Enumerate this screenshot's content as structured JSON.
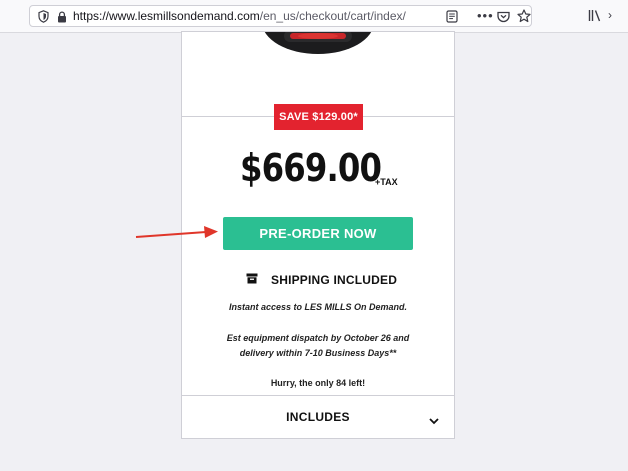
{
  "browser": {
    "url_host": "https://www.lesmillsondemand.com",
    "url_path": "/en_us/checkout/cart/index/",
    "more_label": "•••"
  },
  "offer": {
    "save_badge": "SAVE $129.00*",
    "price": "$669.00",
    "tax_note": "+TAX",
    "preorder_label": "PRE-ORDER NOW",
    "shipping_label": "SHIPPING INCLUDED",
    "access_text": "Instant access to LES MILLS On Demand.",
    "dispatch_line1": "Est equipment dispatch by October 26 and",
    "dispatch_line2": "delivery within 7-10 Business Days**",
    "hurry_text": "Hurry, the only 84 left!",
    "includes_label": "INCLUDES"
  },
  "colors": {
    "save_badge": "#e3232f",
    "preorder_button": "#2bbf92",
    "annotation_arrow": "#e0362a"
  }
}
